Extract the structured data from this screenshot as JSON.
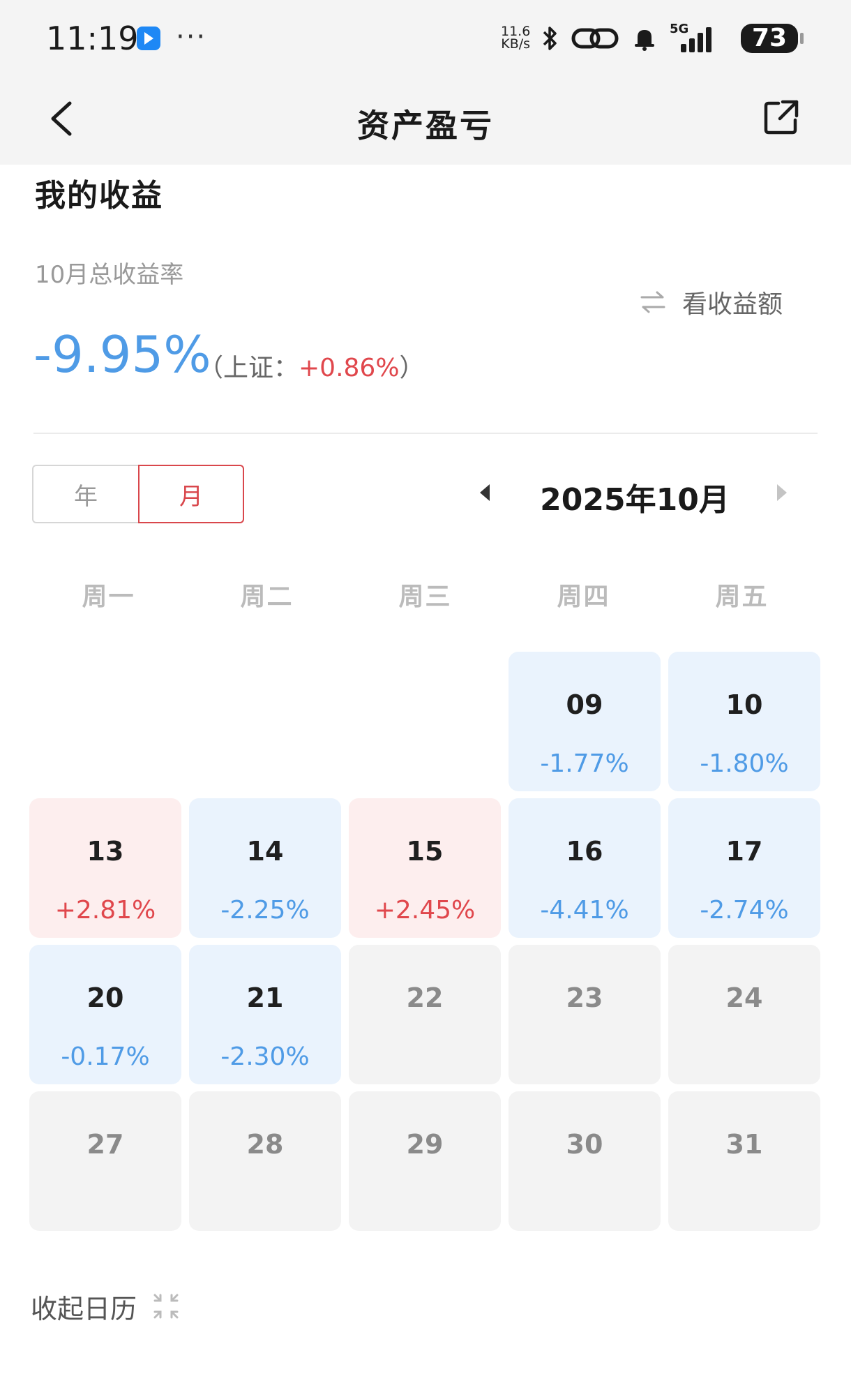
{
  "status_bar": {
    "time": "11:19",
    "more": "···",
    "net_speed_value": "11.6",
    "net_speed_unit": "KB/s",
    "network": "5G",
    "battery": "73"
  },
  "nav": {
    "title": "资产盈亏"
  },
  "summary": {
    "section_title": "我的收益",
    "rate_label": "10月总收益率",
    "rate_value": "-9.95%",
    "bench_open": "（上证：",
    "bench_value": "+0.86%",
    "bench_close": "）",
    "toggle_label": "看收益额"
  },
  "segment": {
    "year": "年",
    "month": "月",
    "selected": "月"
  },
  "month_nav": {
    "label": "2025年10月"
  },
  "weekdays": [
    "周一",
    "周二",
    "周三",
    "周四",
    "周五"
  ],
  "calendar": [
    {
      "day": "",
      "pct": "",
      "state": "empty"
    },
    {
      "day": "",
      "pct": "",
      "state": "empty"
    },
    {
      "day": "",
      "pct": "",
      "state": "empty"
    },
    {
      "day": "09",
      "pct": "-1.77%",
      "state": "neg"
    },
    {
      "day": "10",
      "pct": "-1.80%",
      "state": "neg"
    },
    {
      "day": "13",
      "pct": "+2.81%",
      "state": "pos"
    },
    {
      "day": "14",
      "pct": "-2.25%",
      "state": "neg"
    },
    {
      "day": "15",
      "pct": "+2.45%",
      "state": "pos"
    },
    {
      "day": "16",
      "pct": "-4.41%",
      "state": "neg"
    },
    {
      "day": "17",
      "pct": "-2.74%",
      "state": "neg"
    },
    {
      "day": "20",
      "pct": "-0.17%",
      "state": "neg"
    },
    {
      "day": "21",
      "pct": "-2.30%",
      "state": "neg"
    },
    {
      "day": "22",
      "pct": "",
      "state": "none"
    },
    {
      "day": "23",
      "pct": "",
      "state": "none"
    },
    {
      "day": "24",
      "pct": "",
      "state": "none"
    },
    {
      "day": "27",
      "pct": "",
      "state": "none"
    },
    {
      "day": "28",
      "pct": "",
      "state": "none"
    },
    {
      "day": "29",
      "pct": "",
      "state": "none"
    },
    {
      "day": "30",
      "pct": "",
      "state": "none"
    },
    {
      "day": "31",
      "pct": "",
      "state": "none"
    }
  ],
  "footer": {
    "collapse_label": "收起日历"
  },
  "colors": {
    "negative": "#4f9be6",
    "positive": "#e0474c",
    "accent": "#d9474c"
  },
  "icons": {
    "back": "chevron-left-icon",
    "share": "share-icon",
    "swap": "swap-arrows-icon",
    "prev": "triangle-left-icon",
    "next": "triangle-right-icon",
    "collapse": "collapse-icon"
  }
}
